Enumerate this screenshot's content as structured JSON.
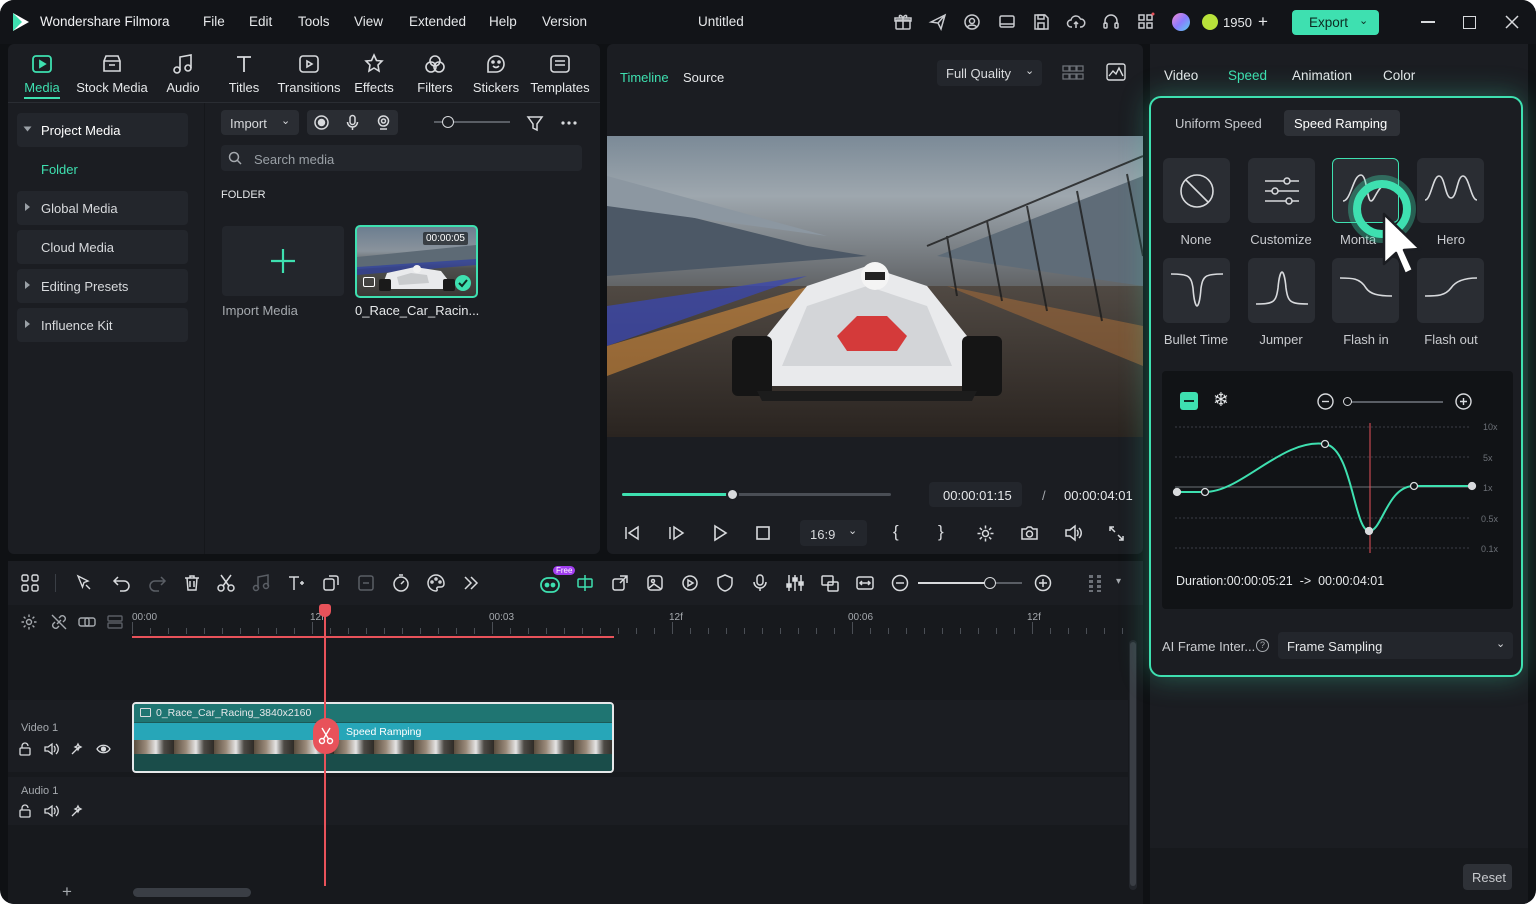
{
  "app": {
    "name": "Wondershare Filmora",
    "title": "Untitled"
  },
  "menu": [
    "File",
    "Edit",
    "Tools",
    "View",
    "Extended",
    "Help",
    "Version"
  ],
  "titlebar": {
    "credits": "1950",
    "export_label": "Export"
  },
  "colors": {
    "accent": "#3ee0b0",
    "playhead": "#e8525a",
    "panel": "#1b1d22",
    "background": "#0f1114"
  },
  "media_tabs": [
    {
      "label": "Media",
      "icon": "media-icon"
    },
    {
      "label": "Stock Media",
      "icon": "stock-media-icon"
    },
    {
      "label": "Audio",
      "icon": "audio-icon"
    },
    {
      "label": "Titles",
      "icon": "titles-icon"
    },
    {
      "label": "Transitions",
      "icon": "transitions-icon"
    },
    {
      "label": "Effects",
      "icon": "effects-icon"
    },
    {
      "label": "Filters",
      "icon": "filters-icon"
    },
    {
      "label": "Stickers",
      "icon": "stickers-icon"
    },
    {
      "label": "Templates",
      "icon": "templates-icon"
    }
  ],
  "sidebar": {
    "project_media": "Project Media",
    "folder": "Folder",
    "global_media": "Global Media",
    "cloud_media": "Cloud Media",
    "editing_presets": "Editing Presets",
    "influence_kit": "Influence Kit"
  },
  "media": {
    "import_label": "Import",
    "search_placeholder": "Search media",
    "folder_heading": "FOLDER",
    "import_media_label": "Import Media",
    "clip_name": "0_Race_Car_Racin...",
    "clip_duration": "00:00:05"
  },
  "preview": {
    "tab_timeline": "Timeline",
    "tab_source": "Source",
    "quality": "Full Quality",
    "current_time": "00:00:01:15",
    "separator": "/",
    "total_time": "00:00:04:01",
    "aspect": "16:9",
    "progress": 0.41
  },
  "right_panel": {
    "tabs": [
      "Video",
      "Speed",
      "Animation",
      "Color"
    ],
    "subtabs": [
      "Uniform Speed",
      "Speed Ramping"
    ],
    "presets": [
      "None",
      "Customize",
      "Montage",
      "Hero",
      "Bullet Time",
      "Jumper",
      "Flash in",
      "Flash out"
    ],
    "montage_visible": "Monta",
    "graph_labels": [
      "10x",
      "5x",
      "1x",
      "0.5x",
      "0.1x"
    ],
    "duration_text": "Duration:00:00:05:21  ->  00:00:04:01",
    "ai_frame_label": "AI Frame Inter...",
    "frame_sampling": "Frame Sampling",
    "reset_label": "Reset"
  },
  "timeline": {
    "ruler": [
      "00:00",
      "12f",
      "00:03",
      "12f",
      "00:06",
      "12f"
    ],
    "video_track": "Video 1",
    "audio_track": "Audio 1",
    "clip_title": "0_Race_Car_Racing_3840x2160",
    "clip_effect": "Speed Ramping",
    "free_badge": "Free"
  }
}
